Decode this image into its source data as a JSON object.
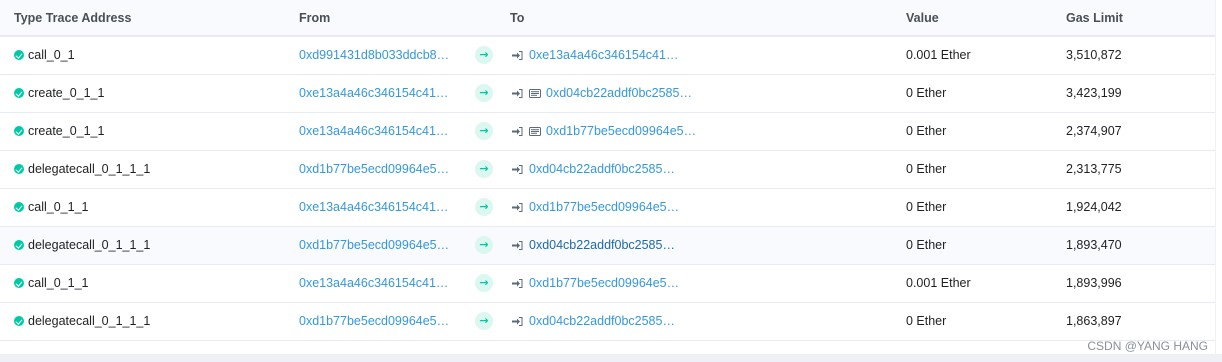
{
  "headers": {
    "type_trace": "Type Trace Address",
    "from": "From",
    "to": "To",
    "value": "Value",
    "gas_limit": "Gas Limit"
  },
  "colors": {
    "link": "#3498db",
    "success": "#00c9a7",
    "header_bg": "#f8fafd"
  },
  "rows": [
    {
      "type": "call_0_1",
      "from": "0xd991431d8b033ddcb8…",
      "to": "0xe13a4a46c346154c41…",
      "to_is_contract": false,
      "value": "0.001 Ether",
      "gas": "3,510,872"
    },
    {
      "type": "create_0_1_1",
      "from": "0xe13a4a46c346154c41…",
      "to": "0xd04cb22addf0bc2585…",
      "to_is_contract": true,
      "value": "0 Ether",
      "gas": "3,423,199"
    },
    {
      "type": "create_0_1_1",
      "from": "0xe13a4a46c346154c41…",
      "to": "0xd1b77be5ecd09964e5…",
      "to_is_contract": true,
      "value": "0 Ether",
      "gas": "2,374,907"
    },
    {
      "type": "delegatecall_0_1_1_1",
      "from": "0xd1b77be5ecd09964e5…",
      "to": "0xd04cb22addf0bc2585…",
      "to_is_contract": false,
      "value": "0 Ether",
      "gas": "2,313,775"
    },
    {
      "type": "call_0_1_1",
      "from": "0xe13a4a46c346154c41…",
      "to": "0xd1b77be5ecd09964e5…",
      "to_is_contract": false,
      "value": "0 Ether",
      "gas": "1,924,042"
    },
    {
      "type": "delegatecall_0_1_1_1",
      "from": "0xd1b77be5ecd09964e5…",
      "to": "0xd04cb22addf0bc2585…",
      "to_is_contract": false,
      "value": "0 Ether",
      "gas": "1,893,470",
      "highlighted": true
    },
    {
      "type": "call_0_1_1",
      "from": "0xe13a4a46c346154c41…",
      "to": "0xd1b77be5ecd09964e5…",
      "to_is_contract": false,
      "value": "0.001 Ether",
      "gas": "1,893,996"
    },
    {
      "type": "delegatecall_0_1_1_1",
      "from": "0xd1b77be5ecd09964e5…",
      "to": "0xd04cb22addf0bc2585…",
      "to_is_contract": false,
      "value": "0 Ether",
      "gas": "1,863,897"
    }
  ],
  "icons": {
    "status": "check-circle-icon",
    "direction": "arrow-right-icon",
    "enter": "sign-in-icon",
    "contract": "contract-icon"
  },
  "watermark": "CSDN @YANG HANG"
}
